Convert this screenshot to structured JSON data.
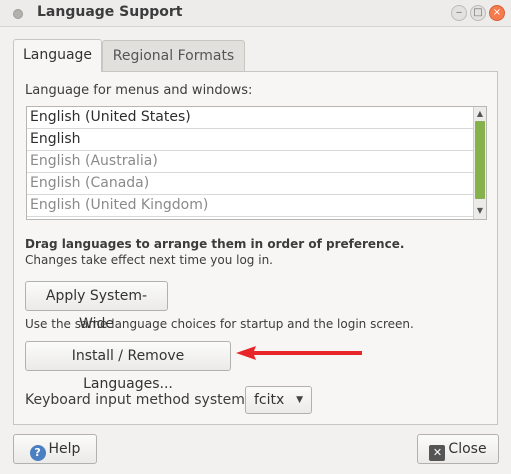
{
  "window": {
    "title": "Language Support",
    "controls": {
      "minimize": "‒",
      "maximize": "□",
      "close": "×"
    }
  },
  "tabs": [
    {
      "label": "Language",
      "active": true
    },
    {
      "label": "Regional Formats",
      "active": false
    }
  ],
  "language": {
    "section_label": "Language for menus and windows:",
    "items": [
      {
        "label": "English (United States)",
        "enabled": true
      },
      {
        "label": "English",
        "enabled": true
      },
      {
        "label": "English (Australia)",
        "enabled": false
      },
      {
        "label": "English (Canada)",
        "enabled": false
      },
      {
        "label": "English (United Kingdom)",
        "enabled": false
      }
    ],
    "hint_bold": "Drag languages to arrange them in order of preference.",
    "hint": "Changes take effect next time you log in.",
    "apply_button": "Apply System-Wide",
    "apply_desc": "Use the same language choices for startup and the login screen.",
    "install_button": "Install / Remove Languages...",
    "keyboard_label": "Keyboard input method system:",
    "keyboard_value": "fcitx"
  },
  "footer": {
    "help_button": "Help",
    "close_button": "Close"
  },
  "icons": {
    "help": "help-icon",
    "close": "close-icon",
    "dropdown": "chevron-down-icon"
  },
  "colors": {
    "scroll_thumb": "#85b24c",
    "annotation_arrow": "#e8262a",
    "close_window_button": "#f37b4d"
  }
}
